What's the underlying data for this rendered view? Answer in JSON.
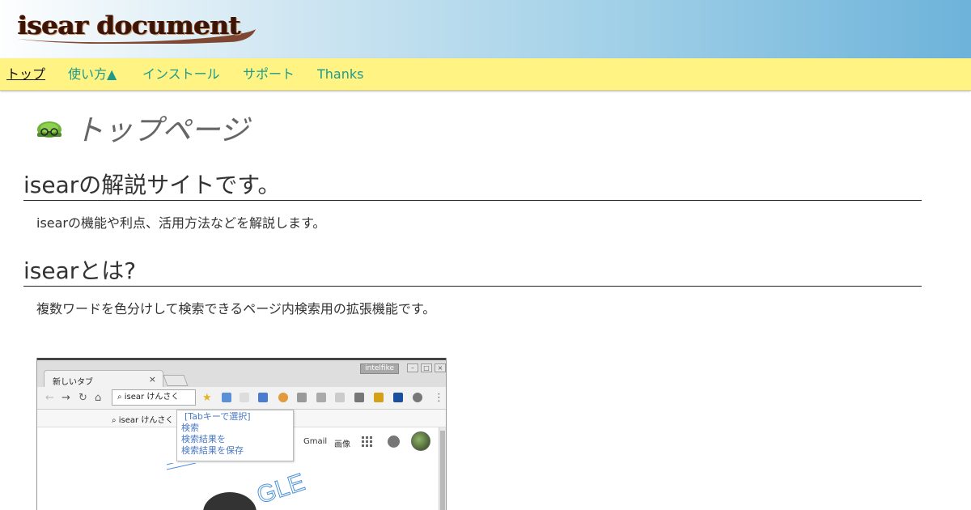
{
  "header": {
    "logo_text": "isear document",
    "colors": {
      "gradient_start": "#fdfefe",
      "gradient_end": "#6db3da",
      "logo": "#3a1408"
    }
  },
  "nav": {
    "background": "#fff384",
    "items": [
      {
        "label": "トップ",
        "active": true
      },
      {
        "label": "使い方▲",
        "active": false
      },
      {
        "label": "インストール",
        "active": false
      },
      {
        "label": "サポート",
        "active": false
      },
      {
        "label": "Thanks",
        "active": false
      }
    ]
  },
  "main": {
    "title_icon": "turtle-with-glasses-icon",
    "page_title": "トップページ",
    "sections": [
      {
        "heading": "isearの解説サイトです。",
        "text": "isearの機能や利点、活用方法などを解説します。"
      },
      {
        "heading": "isearとは?",
        "text": "複数ワードを色分けして検索できるページ内検索用の拡張機能です。"
      }
    ]
  },
  "screenshot": {
    "window_caption": "intelfike",
    "tab_label": "新しいタブ",
    "tab_close": "×",
    "omnibox_text": "isear けんさく",
    "bookmark_text": "isear けんさく",
    "popup_items": [
      "[Tabキーで選択]",
      "検索",
      "検索結果を",
      "検索結果を保存"
    ],
    "links": [
      "Gmail",
      "画像"
    ],
    "doodle_text": "GLE"
  }
}
